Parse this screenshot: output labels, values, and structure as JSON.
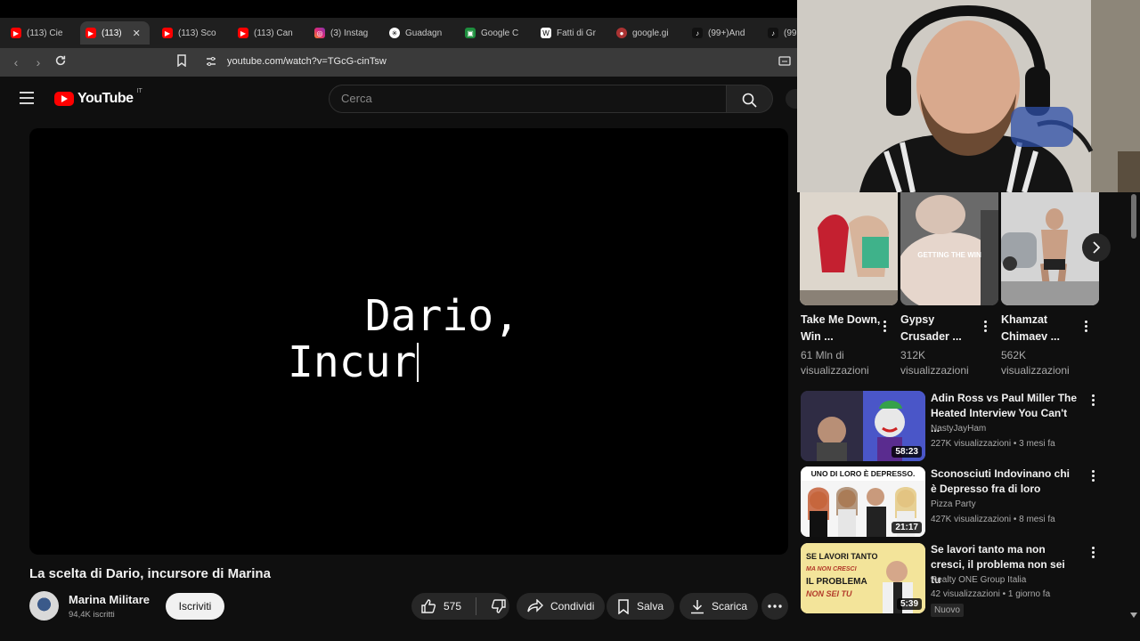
{
  "browser": {
    "tabs": [
      {
        "label": "(113) Cie",
        "icon": "youtube-icon"
      },
      {
        "label": "(113)",
        "icon": "youtube-icon",
        "active": true
      },
      {
        "label": "(113) Sco",
        "icon": "youtube-icon"
      },
      {
        "label": "(113) Can",
        "icon": "youtube-icon"
      },
      {
        "label": "(3) Instag",
        "icon": "instagram-icon"
      },
      {
        "label": "Guadagn",
        "icon": "chatgpt-icon"
      },
      {
        "label": "Google C",
        "icon": "google-classroom-icon"
      },
      {
        "label": "Fatti di Gr",
        "icon": "wikipedia-icon"
      },
      {
        "label": "google.gi",
        "icon": "google-icon"
      },
      {
        "label": "(99+)And",
        "icon": "tiktok-icon"
      },
      {
        "label": "(99",
        "icon": "tiktok-icon"
      }
    ],
    "url": "youtube.com/watch?v=TGcG-cinTsw"
  },
  "header": {
    "logo_text": "YouTube",
    "country_code": "IT",
    "search_placeholder": "Cerca"
  },
  "video": {
    "overlay_line1": "   Dario,",
    "overlay_line2": "Incur",
    "title": "La scelta di Dario, incursore di Marina",
    "channel": "Marina Militare",
    "subscribers": "94,4K iscritti",
    "subscribe_label": "Iscriviti",
    "likes": "575",
    "share_label": "Condividi",
    "save_label": "Salva",
    "download_label": "Scarica"
  },
  "shorts": [
    {
      "title": "Take Me Down, Win ...",
      "views": "61 Mln di visualizzazioni"
    },
    {
      "title": "Gypsy Crusader ...",
      "views": "312K visualizzazioni"
    },
    {
      "title": "Khamzat Chimaev ...",
      "views": "562K visualizzazioni"
    }
  ],
  "shorts_overlay_text": "GETTING THE WIN",
  "recommended": [
    {
      "title": "Adin Ross vs Paul Miller The Heated Interview You Can't ...",
      "channel": "NastyJayHam",
      "meta": "227K visualizzazioni • 3 mesi fa",
      "duration": "58:23"
    },
    {
      "title": "Sconosciuti Indovinano chi è Depresso fra di loro",
      "channel": "Pizza Party",
      "meta": "427K visualizzazioni • 8 mesi fa",
      "duration": "21:17",
      "thumb_text": "UNO DI LORO È DEPRESSO."
    },
    {
      "title": "Se lavori tanto ma non cresci, il problema non sei tu",
      "channel": "Realty ONE Group Italia",
      "meta": "42 visualizzazioni • 1 giorno fa",
      "duration": "5:39",
      "badge": "Nuovo",
      "thumb_text": "SE LAVORI TANTO MA NON CRESCI IL PROBLEMA NON SEI TU"
    }
  ],
  "colors": {
    "youtube_red": "#ff0000",
    "background": "#0f0f0f",
    "chip": "#272727"
  }
}
